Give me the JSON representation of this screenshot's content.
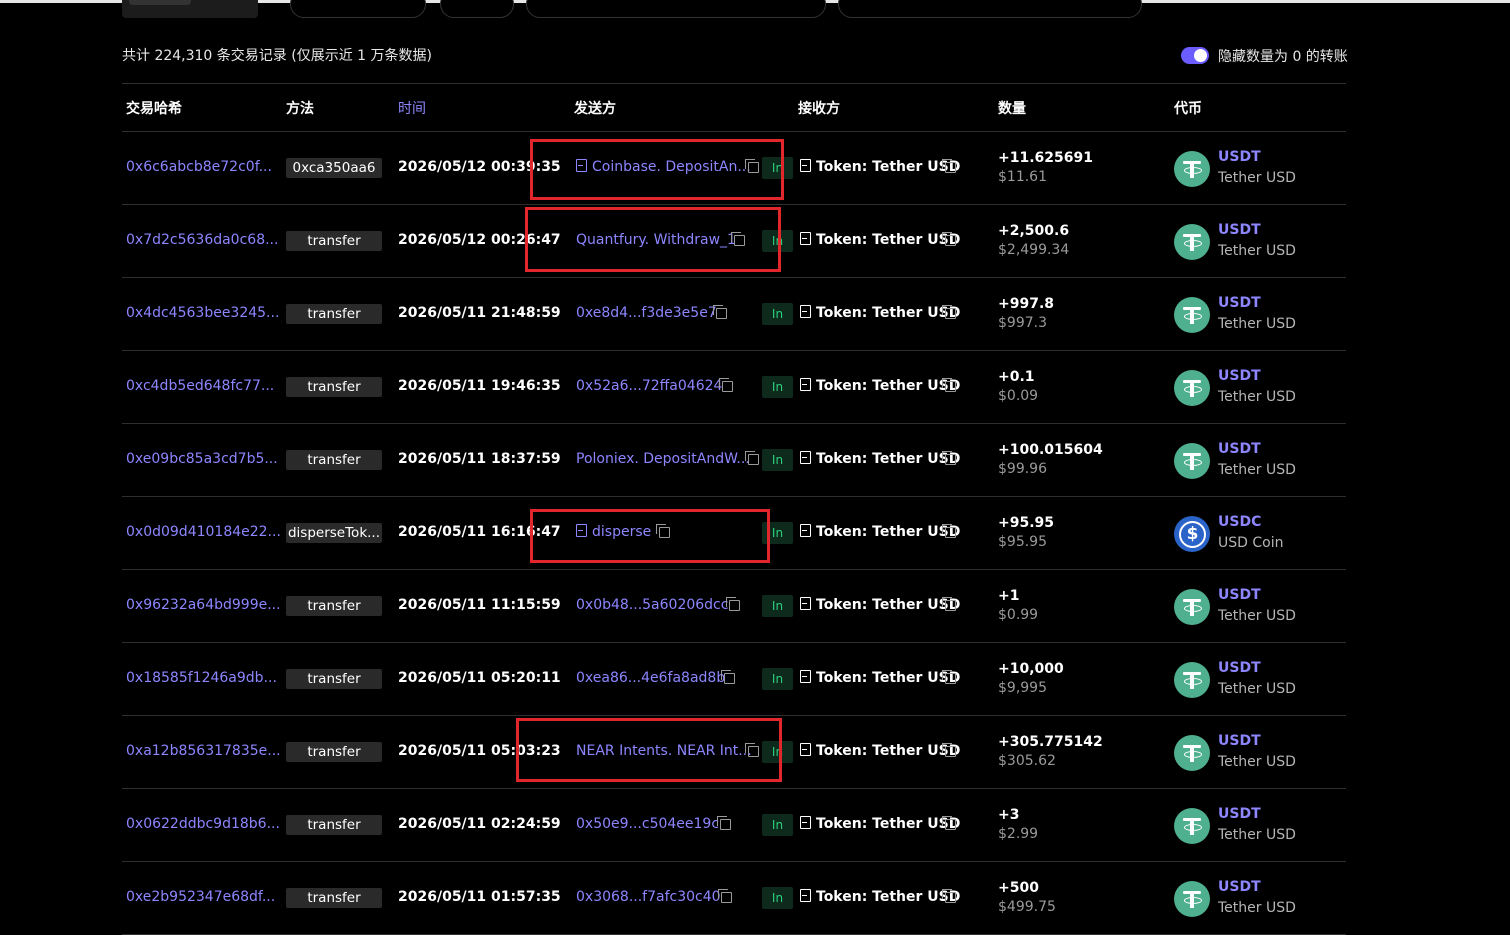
{
  "summary": "共计 224,310 条交易记录 (仅展示近 1 万条数据)",
  "toggle": {
    "label": "隐藏数量为 0 的转账",
    "on": true
  },
  "headers": {
    "hash": "交易哈希",
    "method": "方法",
    "time": "时间",
    "from": "发送方",
    "to": "接收方",
    "amount": "数量",
    "token": "代币"
  },
  "direction_label": "In",
  "rows": [
    {
      "hash": "0x6c6abcb8e72c0f...",
      "method": "0xca350aa6",
      "time": "2026/05/12 00:39:35",
      "from": "Coinbase. DepositAn...",
      "from_contract": true,
      "to": "Token: Tether USD",
      "amount": "+11.625691",
      "usd": "$11.61",
      "symbol": "USDT",
      "token_name": "Tether USD",
      "coin": "usdt"
    },
    {
      "hash": "0x7d2c5636da0c68...",
      "method": "transfer",
      "time": "2026/05/12 00:26:47",
      "from": "Quantfury. Withdraw_1",
      "from_contract": false,
      "to": "Token: Tether USD",
      "amount": "+2,500.6",
      "usd": "$2,499.34",
      "symbol": "USDT",
      "token_name": "Tether USD",
      "coin": "usdt"
    },
    {
      "hash": "0x4dc4563bee3245...",
      "method": "transfer",
      "time": "2026/05/11 21:48:59",
      "from": "0xe8d4...f3de3e5e7",
      "from_contract": false,
      "to": "Token: Tether USD",
      "amount": "+997.8",
      "usd": "$997.3",
      "symbol": "USDT",
      "token_name": "Tether USD",
      "coin": "usdt"
    },
    {
      "hash": "0xc4db5ed648fc77...",
      "method": "transfer",
      "time": "2026/05/11 19:46:35",
      "from": "0x52a6...72ffa04624",
      "from_contract": false,
      "to": "Token: Tether USD",
      "amount": "+0.1",
      "usd": "$0.09",
      "symbol": "USDT",
      "token_name": "Tether USD",
      "coin": "usdt"
    },
    {
      "hash": "0xe09bc85a3cd7b5...",
      "method": "transfer",
      "time": "2026/05/11 18:37:59",
      "from": "Poloniex. DepositAndW...",
      "from_contract": false,
      "to": "Token: Tether USD",
      "amount": "+100.015604",
      "usd": "$99.96",
      "symbol": "USDT",
      "token_name": "Tether USD",
      "coin": "usdt"
    },
    {
      "hash": "0x0d09d410184e22...",
      "method": "disperseTok...",
      "time": "2026/05/11 16:16:47",
      "from": "disperse",
      "from_contract": true,
      "to": "Token: Tether USD",
      "amount": "+95.95",
      "usd": "$95.95",
      "symbol": "USDC",
      "token_name": "USD Coin",
      "coin": "usdc"
    },
    {
      "hash": "0x96232a64bd999e...",
      "method": "transfer",
      "time": "2026/05/11 11:15:59",
      "from": "0x0b48...5a60206dcc",
      "from_contract": false,
      "to": "Token: Tether USD",
      "amount": "+1",
      "usd": "$0.99",
      "symbol": "USDT",
      "token_name": "Tether USD",
      "coin": "usdt"
    },
    {
      "hash": "0x18585f1246a9db...",
      "method": "transfer",
      "time": "2026/05/11 05:20:11",
      "from": "0xea86...4e6fa8ad8b",
      "from_contract": false,
      "to": "Token: Tether USD",
      "amount": "+10,000",
      "usd": "$9,995",
      "symbol": "USDT",
      "token_name": "Tether USD",
      "coin": "usdt"
    },
    {
      "hash": "0xa12b856317835e...",
      "method": "transfer",
      "time": "2026/05/11 05:03:23",
      "from": "NEAR Intents. NEAR Int...",
      "from_contract": false,
      "to": "Token: Tether USD",
      "amount": "+305.775142",
      "usd": "$305.62",
      "symbol": "USDT",
      "token_name": "Tether USD",
      "coin": "usdt"
    },
    {
      "hash": "0x0622ddbc9d18b6...",
      "method": "transfer",
      "time": "2026/05/11 02:24:59",
      "from": "0x50e9...c504ee19c",
      "from_contract": false,
      "to": "Token: Tether USD",
      "amount": "+3",
      "usd": "$2.99",
      "symbol": "USDT",
      "token_name": "Tether USD",
      "coin": "usdt"
    },
    {
      "hash": "0xe2b952347e68df...",
      "method": "transfer",
      "time": "2026/05/11 01:57:35",
      "from": "0x3068...f7afc30c40",
      "from_contract": false,
      "to": "Token: Tether USD",
      "amount": "+500",
      "usd": "$499.75",
      "symbol": "USDT",
      "token_name": "Tether USD",
      "coin": "usdt"
    }
  ],
  "colors": {
    "background": "#000000",
    "link": "#8d86ff",
    "in_badge_text": "#2bd07d",
    "in_badge_bg": "#0e2a1c",
    "highlight_box": "#e1262c",
    "usdt": "#4fb08f",
    "usdc": "#2a64c9"
  },
  "highlighted_rows": [
    0,
    1,
    5,
    8
  ]
}
